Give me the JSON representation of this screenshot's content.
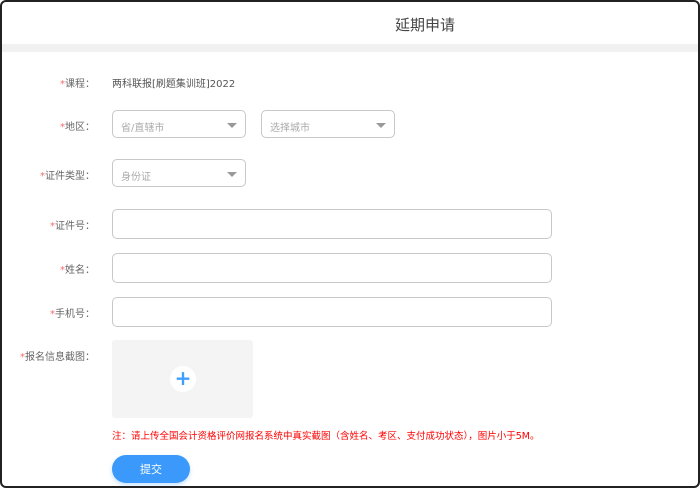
{
  "header": {
    "title": "延期申请"
  },
  "form": {
    "required_mark": "*",
    "course": {
      "label": "课程：",
      "value": "两科联报[刷题集训班]2022"
    },
    "region": {
      "label": "地区：",
      "province_placeholder": "省/直辖市",
      "city_placeholder": "选择城市"
    },
    "id_type": {
      "label": "证件类型：",
      "value": "身份证"
    },
    "id_number": {
      "label": "证件号："
    },
    "name": {
      "label": "姓名："
    },
    "phone": {
      "label": "手机号："
    },
    "screenshot": {
      "label": "报名信息截图："
    },
    "note": "注：请上传全国会计资格评价网报名系统中真实截图（含姓名、考区、支付成功状态），图片小于5M。",
    "submit_label": "提交"
  }
}
